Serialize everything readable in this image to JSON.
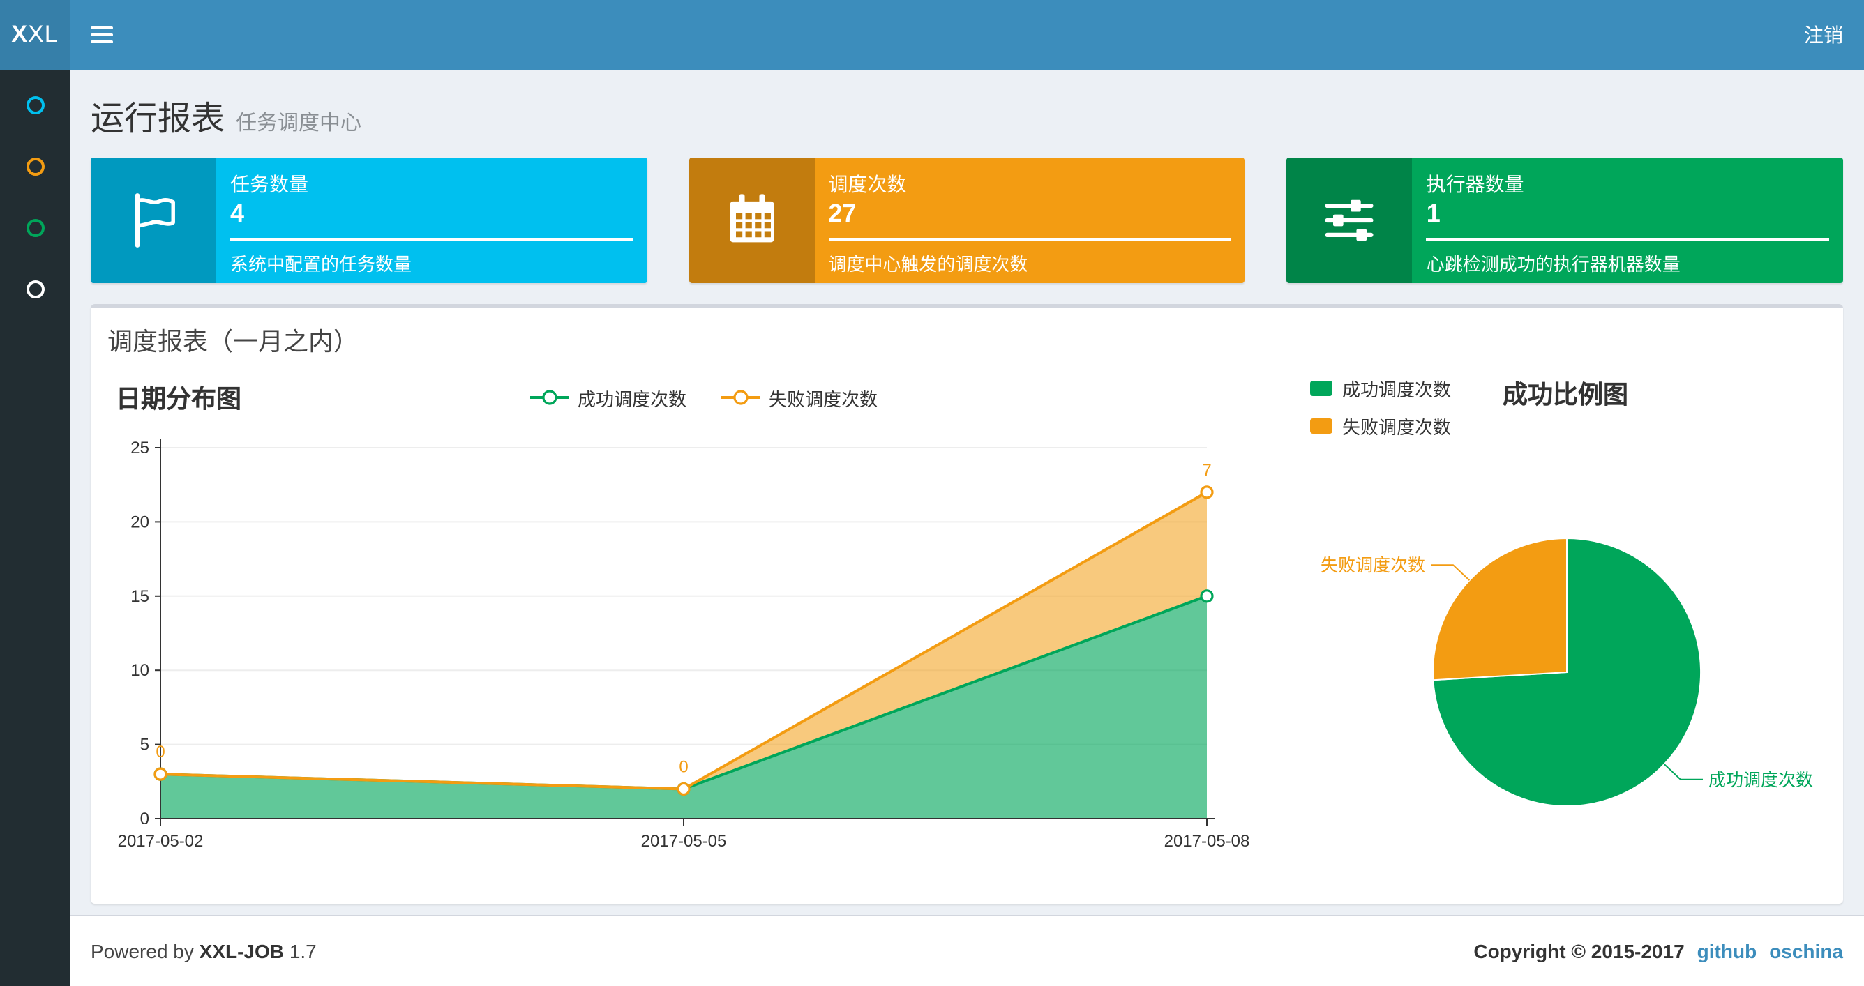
{
  "navbar": {
    "logo_bold": "X",
    "logo_rest": "XL",
    "logout_label": "注销"
  },
  "sidebar": {
    "items": [
      {
        "icon": "circle-icon",
        "color": "#00c0ef"
      },
      {
        "icon": "circle-icon",
        "color": "#f39c12"
      },
      {
        "icon": "circle-icon",
        "color": "#00a65a"
      },
      {
        "icon": "circle-icon",
        "color": "#ffffff"
      }
    ]
  },
  "header": {
    "title": "运行报表",
    "subtitle": "任务调度中心"
  },
  "info_boxes": [
    {
      "icon": "flag-icon",
      "label": "任务数量",
      "value": "4",
      "desc": "系统中配置的任务数量",
      "color": "#00c0ef"
    },
    {
      "icon": "calendar-icon",
      "label": "调度次数",
      "value": "27",
      "desc": "调度中心触发的调度次数",
      "color": "#f39c12"
    },
    {
      "icon": "sliders-icon",
      "label": "执行器数量",
      "value": "1",
      "desc": "心跳检测成功的执行器机器数量",
      "color": "#00a65a"
    }
  ],
  "panel": {
    "title": "调度报表（一月之内）"
  },
  "chart_data": [
    {
      "type": "area",
      "title": "日期分布图",
      "x": [
        "2017-05-02",
        "2017-05-05",
        "2017-05-08"
      ],
      "series": [
        {
          "name": "成功调度次数",
          "color": "#00a65a",
          "values": [
            3,
            2,
            15
          ],
          "stacked": true
        },
        {
          "name": "失败调度次数",
          "color": "#f39c12",
          "values": [
            0,
            0,
            7
          ],
          "stacked": true,
          "point_labels": [
            "0",
            "0",
            "7"
          ]
        }
      ],
      "xlabel": "",
      "ylabel": "",
      "ylim": [
        0,
        25
      ],
      "yticks": [
        0,
        5,
        10,
        15,
        20,
        25
      ],
      "grid": true,
      "legend_position": "top-center"
    },
    {
      "type": "pie",
      "title": "成功比例图",
      "series": [
        {
          "name": "成功调度次数",
          "value": 20,
          "color": "#00a65a"
        },
        {
          "name": "失败调度次数",
          "value": 7,
          "color": "#f39c12"
        }
      ],
      "legend_position": "top-left",
      "labels": "outside-leader-lines"
    }
  ],
  "footer": {
    "powered_by_prefix": "Powered by",
    "product": "XXL-JOB",
    "version": "1.7",
    "copyright": "Copyright © 2015-2017",
    "links": [
      {
        "label": "github"
      },
      {
        "label": "oschina"
      }
    ]
  }
}
